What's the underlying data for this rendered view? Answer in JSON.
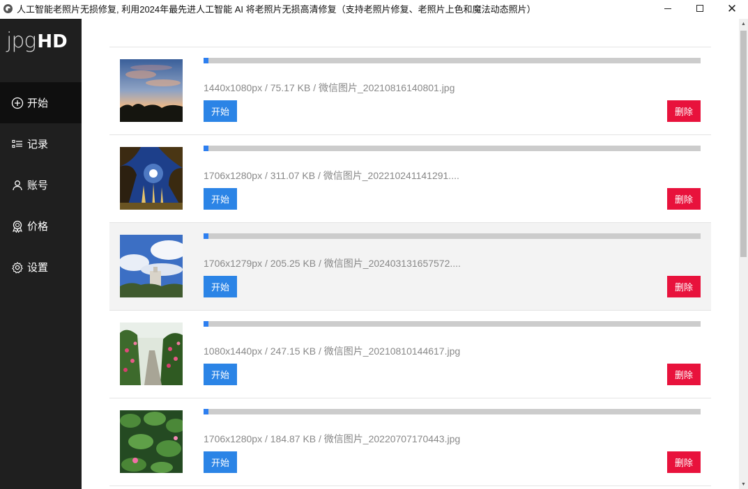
{
  "window": {
    "title": "人工智能老照片无损修复, 利用2024年最先进人工智能 AI 将老照片无损高清修复（支持老照片修复、老照片上色和魔法动态照片）",
    "app_icon": "globe-icon"
  },
  "sidebar": {
    "logo_thin": "jpg",
    "logo_bold": "HD",
    "items": [
      {
        "label": "开始",
        "icon": "plus-circle-icon",
        "active": true
      },
      {
        "label": "记录",
        "icon": "list-icon",
        "active": false
      },
      {
        "label": "账号",
        "icon": "user-icon",
        "active": false
      },
      {
        "label": "价格",
        "icon": "badge-icon",
        "active": false
      },
      {
        "label": "设置",
        "icon": "gear-icon",
        "active": false
      }
    ]
  },
  "files": [
    {
      "info": "1440x1080px / 75.17 KB / 微信图片_20210816140801.jpg",
      "progress": 0.01,
      "start": "开始",
      "delete": "删除",
      "thumb": "sunset-sky"
    },
    {
      "info": "1706x1280px / 311.07 KB / 微信图片_202210241141291....",
      "progress": 0.01,
      "start": "开始",
      "delete": "删除",
      "thumb": "night-trees-sun"
    },
    {
      "info": "1706x1279px / 205.25 KB / 微信图片_202403131657572....",
      "progress": 0.01,
      "start": "开始",
      "delete": "删除",
      "thumb": "blue-sky-building"
    },
    {
      "info": "1080x1440px / 247.15 KB / 微信图片_20210810144617.jpg",
      "progress": 0.01,
      "start": "开始",
      "delete": "删除",
      "thumb": "garden-path-flowers"
    },
    {
      "info": "1706x1280px / 184.87 KB / 微信图片_20220707170443.jpg",
      "progress": 0.01,
      "start": "开始",
      "delete": "删除",
      "thumb": "lotus-leaves"
    }
  ],
  "colors": {
    "sidebar_bg": "#1f1f1f",
    "start_button": "#2b84e6",
    "delete_button": "#e8123c",
    "progress_fill": "#2d7ff0",
    "progress_track": "#cccccc"
  }
}
